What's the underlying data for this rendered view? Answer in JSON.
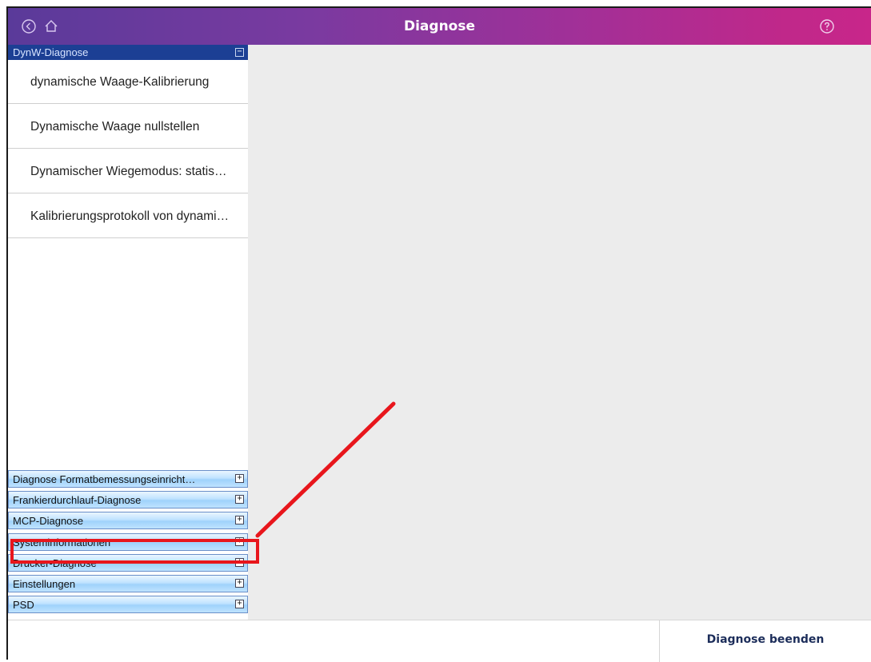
{
  "header": {
    "title": "Diagnose",
    "back_icon": "back-circle-icon",
    "home_icon": "home-icon",
    "help_icon": "help-circle-icon"
  },
  "sidebar": {
    "open_section": {
      "label": "DynW-Diagnose",
      "items": [
        "dynamische Waage-Kalibrierung",
        "Dynamische Waage nullstellen",
        "Dynamischer Wiegemodus: statis…",
        "Kalibrierungsprotokoll von dynami…"
      ]
    },
    "sections": [
      "Diagnose Formatbemessungseinricht…",
      "Frankierdurchlauf-Diagnose",
      "MCP-Diagnose",
      "Systeminformationen",
      "Drucker-Diagnose",
      "Einstellungen",
      "PSD"
    ],
    "collapse_symbol": "−",
    "expand_symbol": "+"
  },
  "footer": {
    "end_label": "Diagnose beenden"
  },
  "colors": {
    "header_start": "#5a3a9a",
    "header_end": "#c8268a",
    "annotation": "#e8161c"
  }
}
